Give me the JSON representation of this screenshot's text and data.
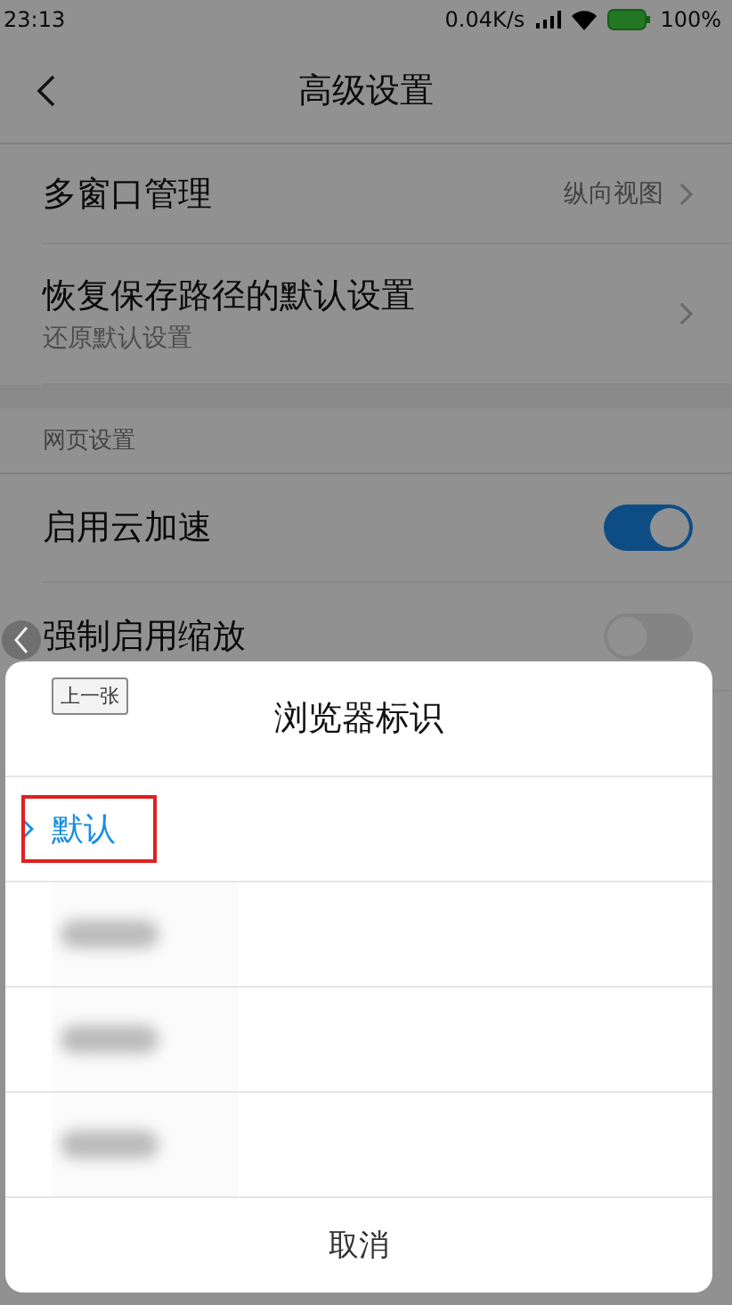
{
  "status_bar": {
    "time": "23:13",
    "speed": "0.04K/s",
    "battery": "100%"
  },
  "header": {
    "title": "高级设置"
  },
  "rows": [
    {
      "kind": "link",
      "title": "多窗口管理",
      "value": "纵向视图"
    },
    {
      "kind": "link",
      "title": "恢复保存路径的默认设置",
      "subtitle": "还原默认设置"
    }
  ],
  "section": {
    "title": "网页设置"
  },
  "toggles": [
    {
      "title": "启用云加速",
      "on": true
    },
    {
      "title": "强制启用缩放",
      "on": false
    }
  ],
  "viewer": {
    "prev_button": "上一张"
  },
  "dialog": {
    "title": "浏览器标识",
    "options": [
      {
        "kind": "text",
        "label": "默认",
        "selected": true,
        "marked": true
      },
      {
        "kind": "blurred",
        "selected": false,
        "marked": false
      },
      {
        "kind": "blurred",
        "selected": false,
        "marked": false
      },
      {
        "kind": "blurred",
        "selected": false,
        "marked": false
      }
    ],
    "cancel": "取消"
  }
}
